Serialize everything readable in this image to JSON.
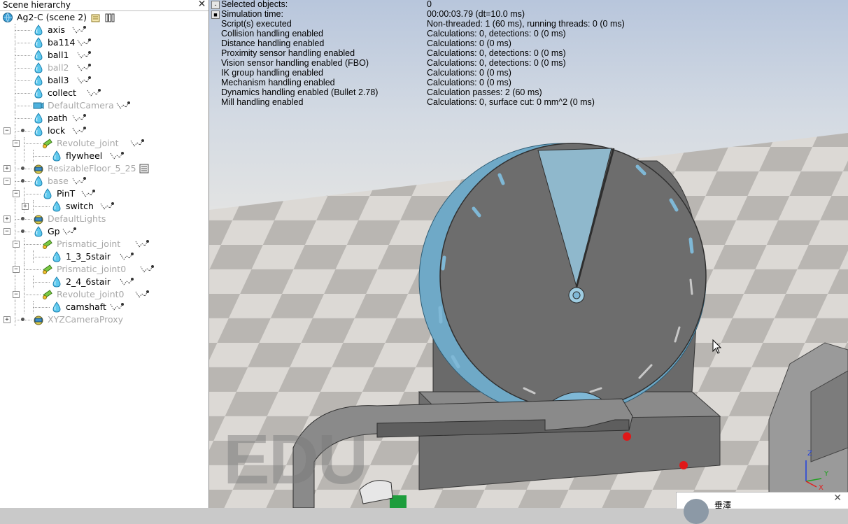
{
  "hierarchy": {
    "title": "Scene hierarchy",
    "close_glyph": "✕",
    "rows": [
      {
        "label": "Ag2-C (scene 2)",
        "depth": 0,
        "icon": "globe-icon",
        "dim": false,
        "expander": null
      },
      {
        "label": "axis",
        "depth": 1,
        "icon": "shape-icon",
        "dim": false,
        "expander": null
      },
      {
        "label": "ba114",
        "depth": 1,
        "icon": "shape-icon",
        "dim": false,
        "expander": null
      },
      {
        "label": "ball1",
        "depth": 1,
        "icon": "shape-icon",
        "dim": false,
        "expander": null
      },
      {
        "label": "ball2",
        "depth": 1,
        "icon": "shape-icon",
        "dim": true,
        "expander": null
      },
      {
        "label": "ball3",
        "depth": 1,
        "icon": "shape-icon",
        "dim": false,
        "expander": null
      },
      {
        "label": "collect",
        "depth": 1,
        "icon": "shape-icon",
        "dim": false,
        "expander": null
      },
      {
        "label": "DefaultCamera",
        "depth": 1,
        "icon": "camera-icon",
        "dim": true,
        "expander": null
      },
      {
        "label": "path",
        "depth": 1,
        "icon": "shape-icon",
        "dim": false,
        "expander": null
      },
      {
        "label": "lock",
        "depth": 1,
        "icon": "shape-icon",
        "dim": false,
        "expander": "minus"
      },
      {
        "label": "Revolute_joint",
        "depth": 2,
        "icon": "joint-icon",
        "dim": true,
        "expander": "minus"
      },
      {
        "label": "flywheel",
        "depth": 3,
        "icon": "shape-icon",
        "dim": false,
        "expander": null
      },
      {
        "label": "ResizableFloor_5_25",
        "depth": 1,
        "icon": "model-icon",
        "dim": true,
        "expander": "plus"
      },
      {
        "label": "base",
        "depth": 1,
        "icon": "shape-icon",
        "dim": true,
        "expander": "minus"
      },
      {
        "label": "PinT",
        "depth": 2,
        "icon": "shape-icon",
        "dim": false,
        "expander": "minus"
      },
      {
        "label": "switch",
        "depth": 3,
        "icon": "shape-icon",
        "dim": false,
        "expander": "plus"
      },
      {
        "label": "DefaultLights",
        "depth": 1,
        "icon": "model-icon",
        "dim": true,
        "expander": "plus"
      },
      {
        "label": "Gp",
        "depth": 1,
        "icon": "shape-icon",
        "dim": false,
        "expander": "minus"
      },
      {
        "label": "Prismatic_joint",
        "depth": 2,
        "icon": "joint-icon",
        "dim": true,
        "expander": "minus"
      },
      {
        "label": "1_3_5stair",
        "depth": 3,
        "icon": "shape-icon",
        "dim": false,
        "expander": null
      },
      {
        "label": "Prismatic_joint0",
        "depth": 2,
        "icon": "joint-icon",
        "dim": true,
        "expander": "minus"
      },
      {
        "label": "2_4_6stair",
        "depth": 3,
        "icon": "shape-icon",
        "dim": false,
        "expander": null
      },
      {
        "label": "Revolute_joint0",
        "depth": 2,
        "icon": "joint-icon",
        "dim": true,
        "expander": "minus"
      },
      {
        "label": "camshaft",
        "depth": 3,
        "icon": "shape-icon",
        "dim": false,
        "expander": null
      },
      {
        "label": "XYZCameraProxy",
        "depth": 1,
        "icon": "model-icon",
        "dim": true,
        "expander": "plus"
      }
    ]
  },
  "info": {
    "rows": [
      {
        "label": "Selected objects:",
        "value": "0"
      },
      {
        "label": "Simulation time:",
        "value": "00:00:03.79 (dt=10.0 ms)"
      },
      {
        "label": "Script(s) executed",
        "value": "Non-threaded: 1 (60 ms), running threads: 0 (0 ms)"
      },
      {
        "label": "Collision handling enabled",
        "value": "Calculations: 0, detections: 0 (0 ms)"
      },
      {
        "label": "Distance handling enabled",
        "value": "Calculations: 0 (0 ms)"
      },
      {
        "label": "Proximity sensor handling enabled",
        "value": "Calculations: 0, detections: 0 (0 ms)"
      },
      {
        "label": "Vision sensor handling enabled (FBO)",
        "value": "Calculations: 0, detections: 0 (0 ms)"
      },
      {
        "label": "IK group handling enabled",
        "value": "Calculations: 0 (0 ms)"
      },
      {
        "label": "Mechanism handling enabled",
        "value": "Calculations: 0 (0 ms)"
      },
      {
        "label": "Dynamics handling enabled (Bullet 2.78)",
        "value": "Calculation passes: 2 (60 ms)"
      },
      {
        "label": "Mill handling enabled",
        "value": "Calculations: 0, surface cut: 0 mm^2 (0 ms)"
      }
    ],
    "btn_glyphs": [
      "-",
      "■"
    ]
  },
  "viewport": {
    "watermark": "EDU",
    "axis_labels": {
      "z": "Z",
      "y": "Y",
      "x": "X"
    }
  },
  "notification": {
    "name": "垂澤",
    "close_glyph": "✕"
  },
  "colors": {
    "accent_blue": "#7fb8d6",
    "panel_bg": "#ffffff",
    "floor_light": "#d9d6d2",
    "floor_dark": "#b7b4b0",
    "machine_gray": "#6b6b6b"
  }
}
